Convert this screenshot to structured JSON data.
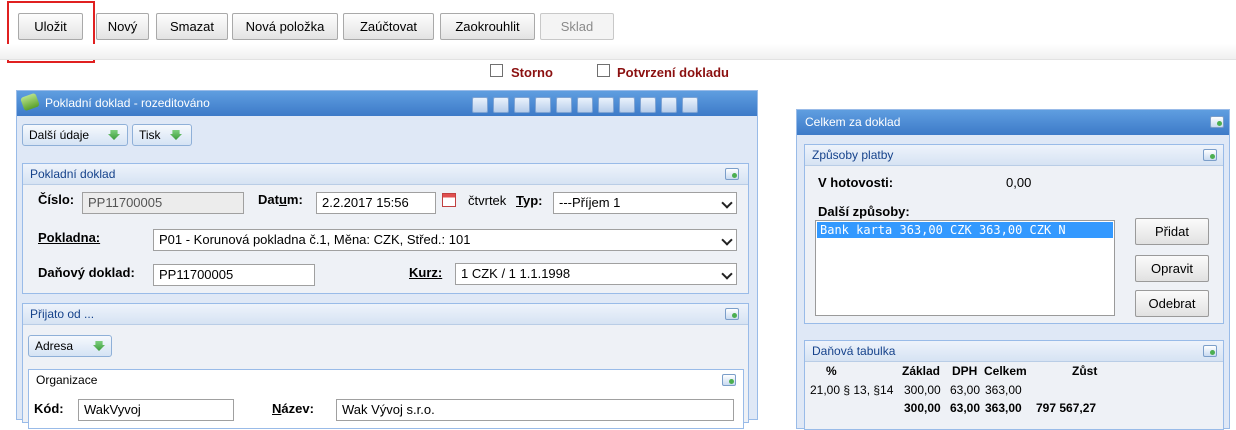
{
  "toolbar": {
    "save": "Uložit",
    "new": "Nový",
    "delete": "Smazat",
    "new_item": "Nová položka",
    "post": "Zaúčtovat",
    "round": "Zaokrouhlit",
    "warehouse": "Sklad"
  },
  "flags": {
    "storno": "Storno",
    "confirm": "Potvrzení dokladu"
  },
  "doc_panel": {
    "title": "Pokladní doklad - rozeditováno",
    "more_info": "Další údaje",
    "print": "Tisk"
  },
  "doc_section": {
    "title": "Pokladní doklad",
    "number_label": "Číslo:",
    "number_value": "PP11700005",
    "date_label": "Datum:",
    "date_value": "2.2.2017 15:56",
    "weekday": "čtvrtek",
    "type_label": "Typ:",
    "type_value": "---Příjem 1",
    "cashbox_label": "Pokladna:",
    "cashbox_value": "P01 - Korunová pokladna č.1, Měna: CZK, Střed.: 101",
    "taxdoc_label": "Daňový doklad:",
    "taxdoc_value": "PP11700005",
    "rate_label": "Kurz:",
    "rate_value": "1 CZK / 1 1.1.1998"
  },
  "received_section": {
    "title": "Přijato od ...",
    "address": "Adresa"
  },
  "org_section": {
    "title": "Organizace",
    "code_label": "Kód:",
    "code_value": "WakVyvoj",
    "name_label": "Název:",
    "name_value": "Wak Vývoj s.r.o."
  },
  "total_panel": {
    "title": "Celkem za doklad"
  },
  "payment": {
    "title": "Způsoby platby",
    "cash_label": "V hotovosti:",
    "cash_value": "0,00",
    "other_label": "Další způsoby:",
    "items": [
      "Bank karta 363,00 CZK 363,00 CZK N"
    ],
    "add": "Přidat",
    "edit": "Opravit",
    "remove": "Odebrat"
  },
  "tax_table": {
    "title": "Daňová tabulka",
    "headers": [
      "%",
      "Základ",
      "DPH",
      "Celkem",
      "Zůst"
    ],
    "rows": [
      [
        "21,00 § 13, §14",
        "300,00",
        "63,00",
        "363,00",
        ""
      ],
      [
        "",
        "300,00",
        "63,00",
        "363,00",
        "797 567,27"
      ]
    ]
  }
}
